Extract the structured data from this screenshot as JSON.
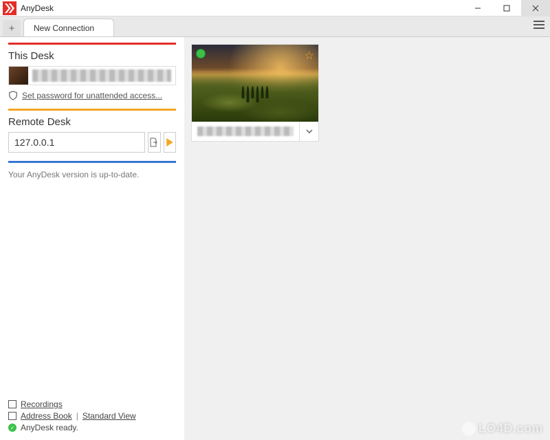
{
  "window": {
    "title": "AnyDesk"
  },
  "tabs": {
    "active": "New Connection"
  },
  "this_desk": {
    "heading": "This Desk",
    "address_redacted": true,
    "unattended_link": "Set password for unattended access..."
  },
  "remote_desk": {
    "heading": "Remote Desk",
    "address_value": "127.0.0.1"
  },
  "update": {
    "message": "Your AnyDesk version is up-to-date."
  },
  "recent": {
    "items": [
      {
        "name_redacted": true,
        "online": true,
        "favorite": true
      }
    ]
  },
  "footer": {
    "recordings": "Recordings",
    "address_book": "Address Book",
    "standard_view": "Standard View",
    "ready": "AnyDesk ready."
  },
  "watermark": "LO4D.com"
}
